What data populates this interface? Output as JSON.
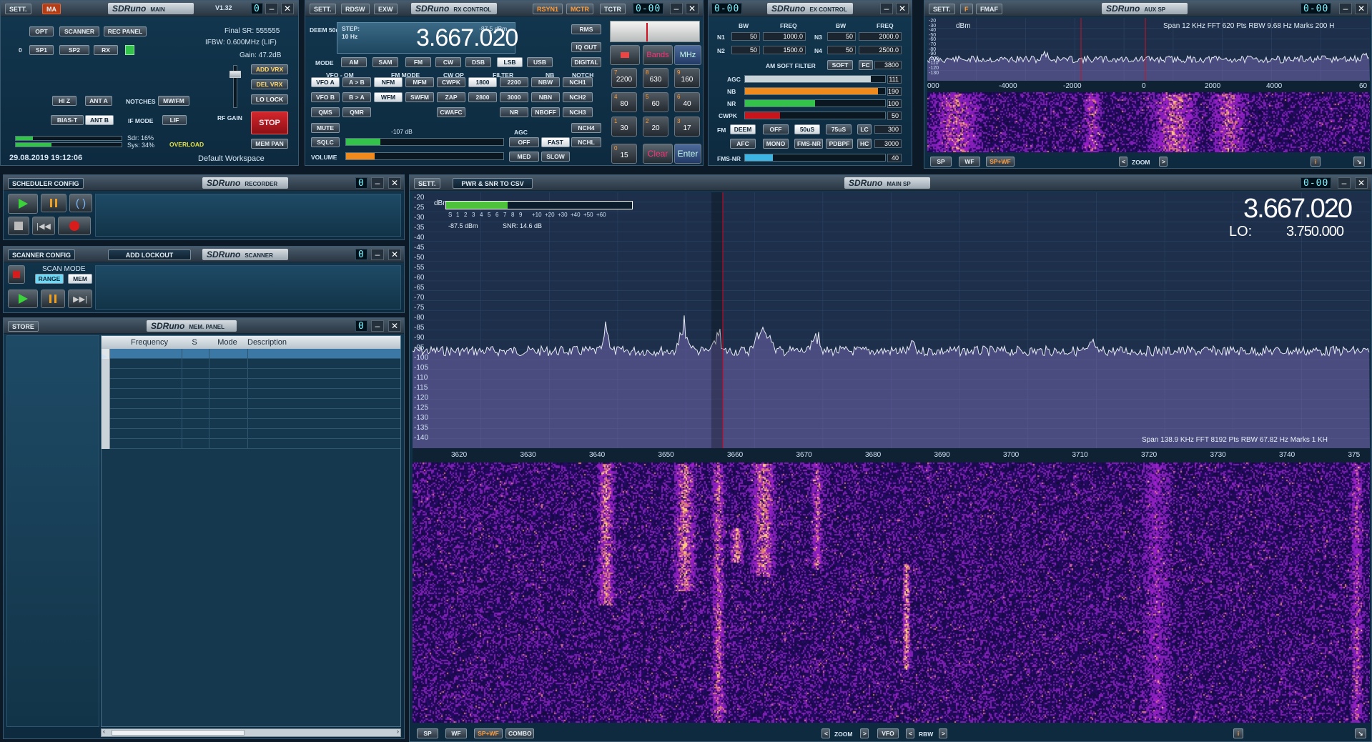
{
  "main": {
    "settings": "SETT.",
    "ma": "MA",
    "brand": "SDRuno",
    "brand_tag": "MAIN",
    "version": "V1.32",
    "buttons": {
      "opt": "OPT",
      "scanner": "SCANNER",
      "rec_panel": "REC PANEL",
      "sp1": "SP1",
      "sp2": "SP2",
      "rx": "RX",
      "hiz": "HI Z",
      "anta": "ANT A",
      "biast": "BIAS-T",
      "antb": "ANT B",
      "mwfm": "MW/FM",
      "lif": "LIF",
      "add_vrx": "ADD VRX",
      "del_vrx": "DEL VRX",
      "lo_lock": "LO LOCK",
      "stop": "STOP",
      "mem_pan": "MEM PAN"
    },
    "labels": {
      "zero": "0",
      "notches": "NOTCHES",
      "if_mode": "IF MODE",
      "rf_gain": "RF GAIN",
      "overload": "OVERLOAD"
    },
    "final_sr": "Final SR: 555555",
    "ifbw": "IFBW: 0.600MHz (LIF)",
    "gain": "Gain: 47.2dB",
    "sdr": "Sdr: 16%",
    "sys": "Sys: 34%",
    "sdr_level": 0.16,
    "sys_level": 0.34,
    "datetime": "29.08.2019 19:12:06",
    "workspace": "Default Workspace"
  },
  "rx": {
    "settings": "SETT.",
    "rdsw": "RDSW",
    "exw": "EXW",
    "brand": "SDRuno",
    "brand_tag": "RX CONTROL",
    "rsyn": "RSYN1",
    "mctr": "MCTR",
    "tctr": "TCTR",
    "seg": "0-00",
    "deem": "DEEM 50u",
    "step_label": "STEP:",
    "step_value": "10 Hz",
    "frequency": "3.667.020",
    "dbm": "-87.5 dBm",
    "rms": "RMS",
    "iq_out": "IQ OUT",
    "digital": "DIGITAL",
    "mode_label": "MODE",
    "modes": [
      "AM",
      "SAM",
      "FM",
      "CW",
      "DSB",
      "LSB",
      "USB"
    ],
    "col_labels": {
      "vfo": "VFO - QM",
      "fm_mode": "FM MODE",
      "cw_op": "CW OP",
      "filter": "FILTER",
      "nb": "NB",
      "notch": "NOTCH",
      "agc": "AGC",
      "sqlc_db": "-107 dB"
    },
    "row1": [
      "VFO A",
      "A > B",
      "NFM",
      "MFM",
      "CWPK",
      "1800",
      "2200",
      "NBW",
      "NCH1"
    ],
    "row2": [
      "VFO B",
      "B > A",
      "WFM",
      "SWFM",
      "ZAP",
      "2800",
      "3000",
      "NBN",
      "NCH2"
    ],
    "row3": [
      "QMS",
      "QMR",
      "CWAFC",
      "NR",
      "NBOFF",
      "NCH3"
    ],
    "mute": "MUTE",
    "nch4": "NCH4",
    "sqlc": "SQLC",
    "off": "OFF",
    "fast": "FAST",
    "nchl": "NCHL",
    "volume": "VOLUME",
    "med": "MED",
    "slow": "SLOW",
    "sqlc_level": 0.22,
    "volume_level": 0.18,
    "keypad": [
      {
        "sub": "7",
        "val": "2200"
      },
      {
        "sub": "8",
        "val": "630"
      },
      {
        "sub": "9",
        "val": "160"
      },
      {
        "sub": "4",
        "val": "80"
      },
      {
        "sub": "5",
        "val": "60"
      },
      {
        "sub": "6",
        "val": "40"
      },
      {
        "sub": "1",
        "val": "30"
      },
      {
        "sub": "2",
        "val": "20"
      },
      {
        "sub": "3",
        "val": "17"
      },
      {
        "sub": "0",
        "val": "15"
      }
    ],
    "bands": "Bands",
    "mhz": "MHz",
    "clear": "Clear",
    "enter": "Enter"
  },
  "ex": {
    "seg": "0-00",
    "brand": "SDRuno",
    "brand_tag": "EX CONTROL",
    "hdr": {
      "bw": "BW",
      "freq": "FREQ",
      "bw2": "BW",
      "freq2": "FREQ"
    },
    "n1": "N1",
    "n1_bw": "50",
    "n1_freq": "1000.0",
    "n3": "N3",
    "n3_bw": "50",
    "n3_freq": "2000.0",
    "n2": "N2",
    "n2_bw": "50",
    "n2_freq": "1500.0",
    "n4": "N4",
    "n4_bw": "50",
    "n4_freq": "2500.0",
    "am_soft": "AM SOFT FILTER",
    "soft": "SOFT",
    "fc": "FC",
    "fc_val": "3800",
    "agc": "AGC",
    "agc_val": "111",
    "agc_level": 0.9,
    "nb": "NB",
    "nb_val": "190",
    "nb_level": 0.95,
    "nr": "NR",
    "nr_val": "100",
    "nr_level": 0.5,
    "cwpk": "CWPK",
    "cwpk_val": "50",
    "cwpk_level": 0.25,
    "fm": "FM",
    "deem": "DEEM",
    "off": "OFF",
    "d50": "50uS",
    "d75": "75uS",
    "lc": "LC",
    "lc_val": "300",
    "afc": "AFC",
    "mono": "MONO",
    "fmsnr": "FMS-NR",
    "pdbpf": "PDBPF",
    "hc": "HC",
    "hc_val": "3000",
    "fmsnr_label": "FMS-NR",
    "fmsnr_val": "40",
    "fmsnr_level": 0.2
  },
  "aux": {
    "settings": "SETT.",
    "f": "F",
    "fmaf": "FMAF",
    "brand": "SDRuno",
    "brand_tag": "AUX SP",
    "seg": "0-00",
    "dbm": "dBm",
    "stats": "Span 12 KHz  FFT 620 Pts  RBW 9.68 Hz  Marks 200 H",
    "yticks": [
      "-20",
      "-30",
      "-40",
      "-50",
      "-60",
      "-70",
      "-80",
      "-90",
      "-100",
      "-110",
      "-120",
      "-130"
    ],
    "xticks": [
      "000",
      "-4000",
      "-2000",
      "0",
      "2000",
      "4000",
      "60"
    ],
    "sp": "SP",
    "wf": "WF",
    "spwf": "SP+WF",
    "zoom": "ZOOM",
    "info": "i"
  },
  "recorder": {
    "config": "SCHEDULER CONFIG",
    "brand": "SDRuno",
    "brand_tag": "RECORDER",
    "seg": "0"
  },
  "scanner": {
    "config": "SCANNER CONFIG",
    "add_lockout": "ADD LOCKOUT",
    "brand": "SDRuno",
    "brand_tag": "SCANNER",
    "seg": "0",
    "scan_mode": "SCAN MODE",
    "range": "RANGE",
    "mem": "MEM"
  },
  "mem": {
    "store": "STORE",
    "brand": "SDRuno",
    "brand_tag": "MEM. PANEL",
    "seg": "0",
    "columns": [
      "Frequency",
      "S",
      "Mode",
      "Description"
    ]
  },
  "mainsp": {
    "settings": "SETT.",
    "export": "PWR & SNR TO CSV",
    "brand": "SDRuno",
    "brand_tag": "MAIN SP",
    "seg": "0-00",
    "frequency": "3.667.020",
    "lo_label": "LO:",
    "lo_value": "3.750.000",
    "dbm": "dBm",
    "smeter_ticks": [
      "S",
      "1",
      "2",
      "3",
      "4",
      "5",
      "6",
      "7",
      "8",
      "9",
      "+10",
      "+20",
      "+30",
      "+40",
      "+50",
      "+60"
    ],
    "smeter_level": 0.33,
    "level_text": "-87.5 dBm",
    "snr": "SNR: 14.6 dB",
    "yticks": [
      "-20",
      "-25",
      "-30",
      "-35",
      "-40",
      "-45",
      "-50",
      "-55",
      "-60",
      "-65",
      "-70",
      "-75",
      "-80",
      "-85",
      "-90",
      "-95",
      "-100",
      "-105",
      "-110",
      "-115",
      "-120",
      "-125",
      "-130",
      "-135",
      "-140"
    ],
    "xticks": [
      "3620",
      "3630",
      "3640",
      "3650",
      "3660",
      "3670",
      "3680",
      "3690",
      "3700",
      "3710",
      "3720",
      "3730",
      "3740",
      "375"
    ],
    "stats": "Span 138.9 KHz  FFT 8192 Pts  RBW 67.82 Hz  Marks 1 KH",
    "sp": "SP",
    "wf": "WF",
    "spwf": "SP+WF",
    "combo": "COMBO",
    "zoom": "ZOOM",
    "vfo": "VFO",
    "rbw": "RBW",
    "info": "i"
  },
  "colors": {
    "accent": "#6fd8f5",
    "green": "#33c24a",
    "orange": "#f08a1c",
    "red": "#b5151b",
    "overload": "#e8e03c"
  }
}
